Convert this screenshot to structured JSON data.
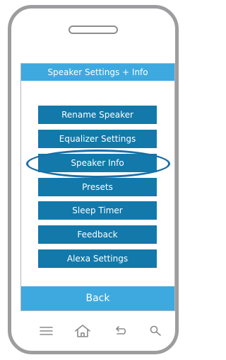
{
  "header": {
    "title": "Speaker Settings + Info"
  },
  "menu": {
    "items": [
      {
        "label": "Rename Speaker"
      },
      {
        "label": "Equalizer Settings"
      },
      {
        "label": "Speaker Info"
      },
      {
        "label": "Presets"
      },
      {
        "label": "Sleep Timer"
      },
      {
        "label": "Feedback"
      },
      {
        "label": "Alexa Settings"
      }
    ],
    "highlighted_index": 2
  },
  "back": {
    "label": "Back"
  },
  "nav": {
    "icons": [
      "menu-icon",
      "home-icon",
      "back-arrow-icon",
      "search-icon"
    ]
  },
  "colors": {
    "header_bar": "#3ea9df",
    "button": "#1279aa",
    "highlight_ring": "#1a6ea8",
    "phone_frame": "#9d9d9f"
  }
}
